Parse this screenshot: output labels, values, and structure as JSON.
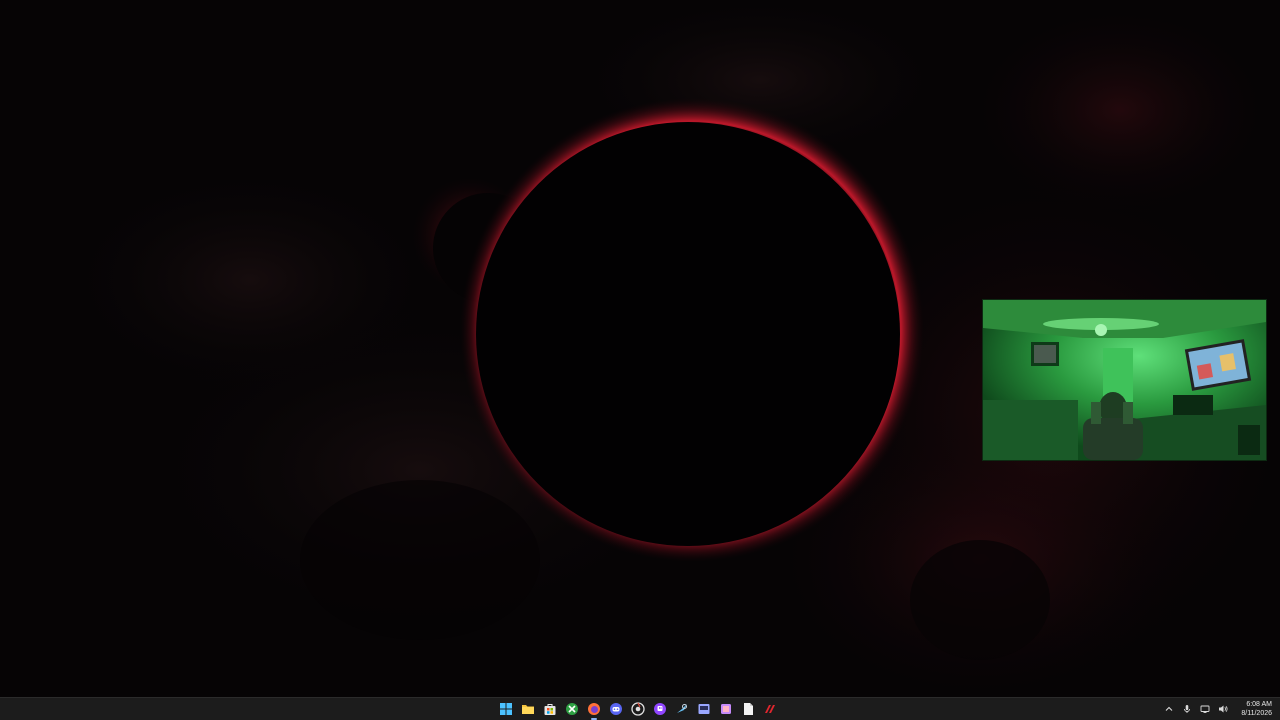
{
  "taskbar": {
    "pinned": [
      {
        "name": "start-button",
        "icon": "windows-start-icon",
        "color": "#4cc2ff"
      },
      {
        "name": "file-explorer-button",
        "icon": "folder-icon",
        "color": "#f3c33f"
      },
      {
        "name": "microsoft-store-button",
        "icon": "store-icon",
        "color": "#e6e6e6"
      },
      {
        "name": "xbox-button",
        "icon": "xbox-icon",
        "color": "#2ea043"
      },
      {
        "name": "firefox-button",
        "icon": "firefox-icon",
        "color": "#ff7139"
      },
      {
        "name": "discord-button",
        "icon": "discord-icon",
        "color": "#5865f2"
      },
      {
        "name": "chrome-button",
        "icon": "chrome-icon",
        "color": "#e0e0e0"
      },
      {
        "name": "twitch-button",
        "icon": "twitch-icon",
        "color": "#9146ff"
      },
      {
        "name": "steam-button",
        "icon": "steam-icon",
        "color": "#66c0f4"
      },
      {
        "name": "app-button-1",
        "icon": "app-icon",
        "color": "#9aa7ff"
      },
      {
        "name": "app-button-2",
        "icon": "app-icon",
        "color": "#c58af9"
      },
      {
        "name": "notepad-button",
        "icon": "document-icon",
        "color": "#f2f2f2"
      },
      {
        "name": "msi-afterburner-button",
        "icon": "afterburner-icon",
        "color": "#e0262e"
      }
    ]
  },
  "tray": {
    "icons": [
      "chevron-up-icon",
      "microphone-icon",
      "network-icon",
      "volume-icon"
    ],
    "time": "6:08 AM",
    "date": "8/11/2026"
  },
  "colors": {
    "taskbar_bg": "#1c1c1c",
    "eclipse_glow": "#c0182a",
    "webcam_tint": "#1f8a33"
  }
}
